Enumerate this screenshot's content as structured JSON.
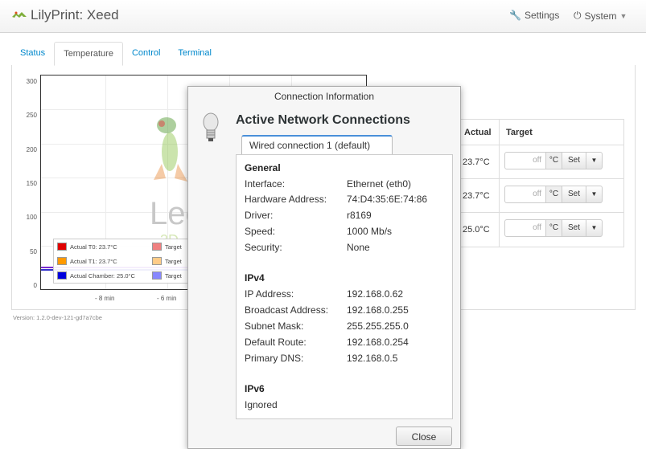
{
  "navbar": {
    "brand": "LilyPrint: Xeed",
    "settings_label": "Settings",
    "system_label": "System"
  },
  "tabs": [
    {
      "label": "Status"
    },
    {
      "label": "Temperature"
    },
    {
      "label": "Control"
    },
    {
      "label": "Terminal"
    }
  ],
  "graph": {
    "y_ticks": [
      "300",
      "250",
      "200",
      "150",
      "100",
      "50",
      "0"
    ],
    "x_ticks": [
      "- 8 min",
      "- 6 min"
    ],
    "watermark": "Leo",
    "watermark_sub": "3D",
    "legend": [
      {
        "label": "Actual T0: 23.7°C",
        "target_label": "Target",
        "color": "#e00000",
        "target_color": "#f08080"
      },
      {
        "label": "Actual T1: 23.7°C",
        "target_label": "Target",
        "color": "#ff9900",
        "target_color": "#ffcc88"
      },
      {
        "label": "Actual Chamber: 25.0°C",
        "target_label": "Target",
        "color": "#0000dd",
        "target_color": "#8888ff"
      }
    ]
  },
  "version": "Version: 1.2.0-dev-121-gd7a7cbe",
  "temp_table": {
    "col_actual": "Actual",
    "col_target": "Target",
    "rows": [
      {
        "actual": "23.7°C",
        "placeholder": "off",
        "unit": "°C",
        "set_label": "Set"
      },
      {
        "actual": "23.7°C",
        "placeholder": "off",
        "unit": "°C",
        "set_label": "Set"
      },
      {
        "actual": "25.0°C",
        "placeholder": "off",
        "unit": "°C",
        "set_label": "Set"
      }
    ]
  },
  "dialog": {
    "title": "Connection Information",
    "heading": "Active Network Connections",
    "tab_label": "Wired connection 1 (default)",
    "general_title": "General",
    "general": [
      {
        "key": "Interface:",
        "value": "Ethernet (eth0)"
      },
      {
        "key": "Hardware Address:",
        "value": "74:D4:35:6E:74:86"
      },
      {
        "key": "Driver:",
        "value": "r8169"
      },
      {
        "key": "Speed:",
        "value": "1000 Mb/s"
      },
      {
        "key": "Security:",
        "value": "None"
      }
    ],
    "ipv4_title": "IPv4",
    "ipv4": [
      {
        "key": "IP Address:",
        "value": "192.168.0.62"
      },
      {
        "key": "Broadcast Address:",
        "value": "192.168.0.255"
      },
      {
        "key": "Subnet Mask:",
        "value": "255.255.255.0"
      },
      {
        "key": "Default Route:",
        "value": "192.168.0.254"
      },
      {
        "key": "Primary DNS:",
        "value": "192.168.0.5"
      }
    ],
    "ipv6_title": "IPv6",
    "ipv6_value": "Ignored",
    "close_label": "Close"
  }
}
